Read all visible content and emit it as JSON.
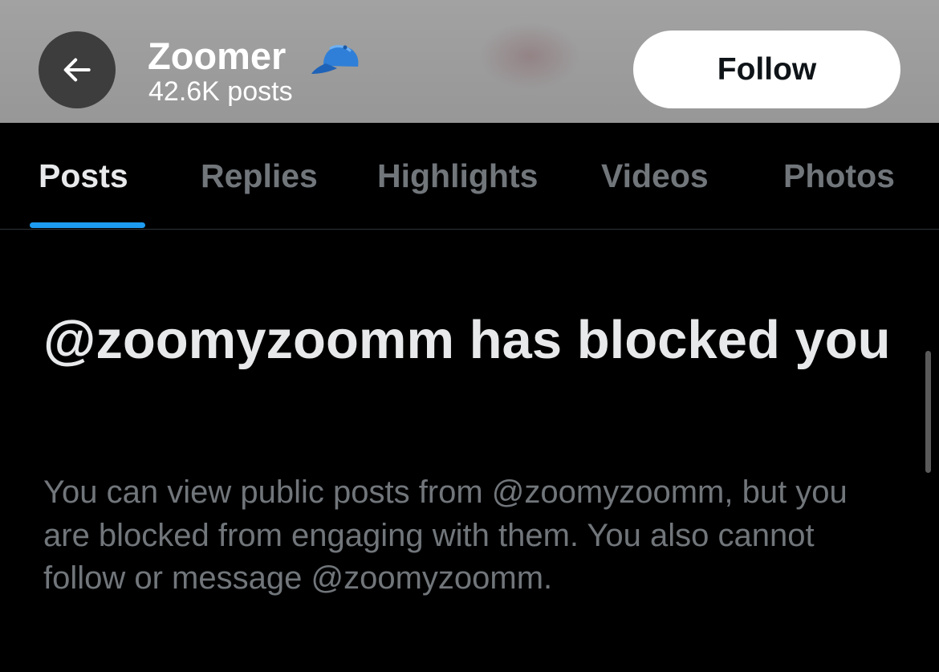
{
  "header": {
    "back_icon": "arrow-left-icon",
    "display_name": "Zoomer",
    "badge_icon": "blue-cap-icon",
    "post_count": "42.6K posts",
    "follow_label": "Follow"
  },
  "tabs": [
    {
      "label": "Posts",
      "active": true
    },
    {
      "label": "Replies",
      "active": false
    },
    {
      "label": "Highlights",
      "active": false
    },
    {
      "label": "Videos",
      "active": false
    },
    {
      "label": "Photos",
      "active": false
    }
  ],
  "blocked": {
    "heading": "@zoomyzoomm has blocked you",
    "message": "You can view public posts from @zoomyzoomm, but you are blocked from engaging with them. You also cannot follow or message @zoomyzoomm."
  },
  "colors": {
    "accent": "#1d9bf0",
    "primary_text": "#e7e9ea",
    "secondary_text": "#71767b",
    "background": "#000000"
  }
}
